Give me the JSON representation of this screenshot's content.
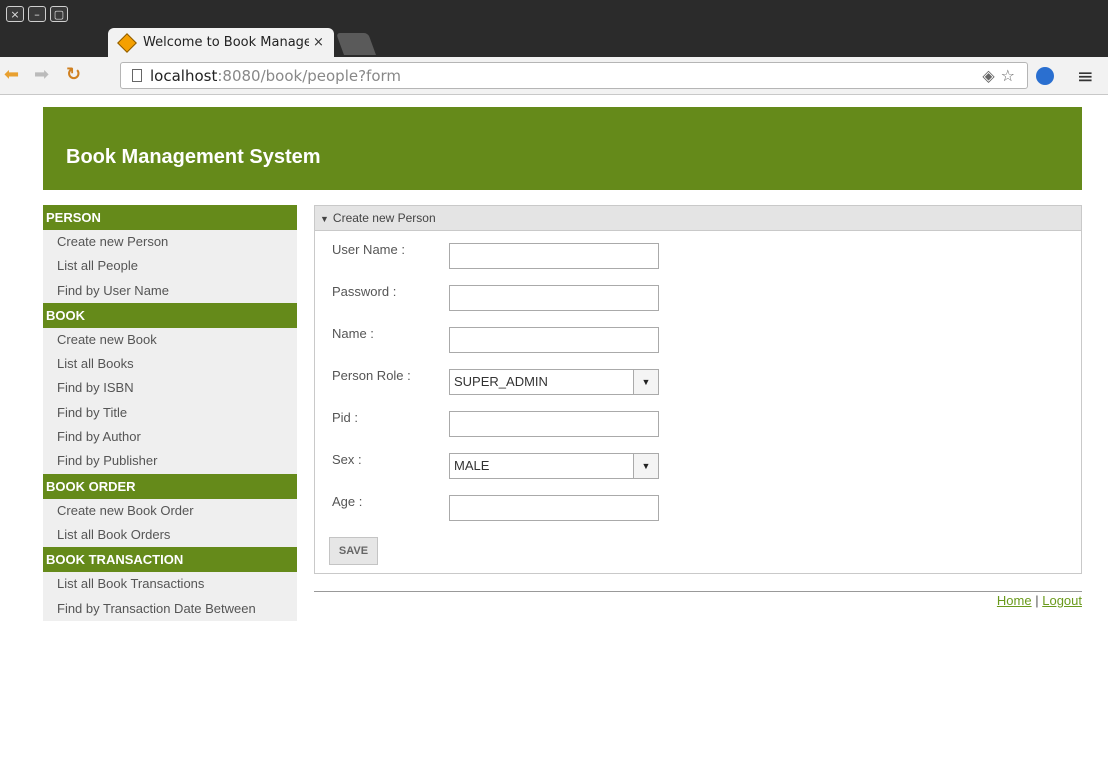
{
  "browser": {
    "window_buttons": [
      "×",
      "–",
      "▢"
    ],
    "tab_title": "Welcome to Book Management System",
    "tab_close": "×",
    "url_host": "localhost",
    "url_path": ":8080/book/people?form"
  },
  "app": {
    "title": "Book Management System"
  },
  "sidebar": {
    "sections": [
      {
        "title": "PERSON",
        "items": [
          "Create new Person",
          "List all People",
          "Find by User Name"
        ]
      },
      {
        "title": "BOOK",
        "items": [
          "Create new Book",
          "List all Books",
          "Find by ISBN",
          "Find by Title",
          "Find by Author",
          "Find by Publisher"
        ]
      },
      {
        "title": "BOOK ORDER",
        "items": [
          "Create new Book Order",
          "List all Book Orders"
        ]
      },
      {
        "title": "BOOK TRANSACTION",
        "items": [
          "List all Book Transactions",
          "Find by Transaction Date Between"
        ]
      }
    ]
  },
  "form": {
    "panel_title": "Create new Person",
    "fields": {
      "username": {
        "label": "User Name :",
        "value": ""
      },
      "password": {
        "label": "Password :",
        "value": ""
      },
      "name": {
        "label": "Name :",
        "value": ""
      },
      "role": {
        "label": "Person Role :",
        "value": "SUPER_ADMIN"
      },
      "pid": {
        "label": "Pid :",
        "value": ""
      },
      "sex": {
        "label": "Sex :",
        "value": "MALE"
      },
      "age": {
        "label": "Age :",
        "value": ""
      }
    },
    "save_label": "SAVE"
  },
  "footer": {
    "home": "Home",
    "separator": "|",
    "logout": "Logout"
  },
  "colors": {
    "brand_green": "#658a1a",
    "link_green": "#6a9a1c"
  }
}
